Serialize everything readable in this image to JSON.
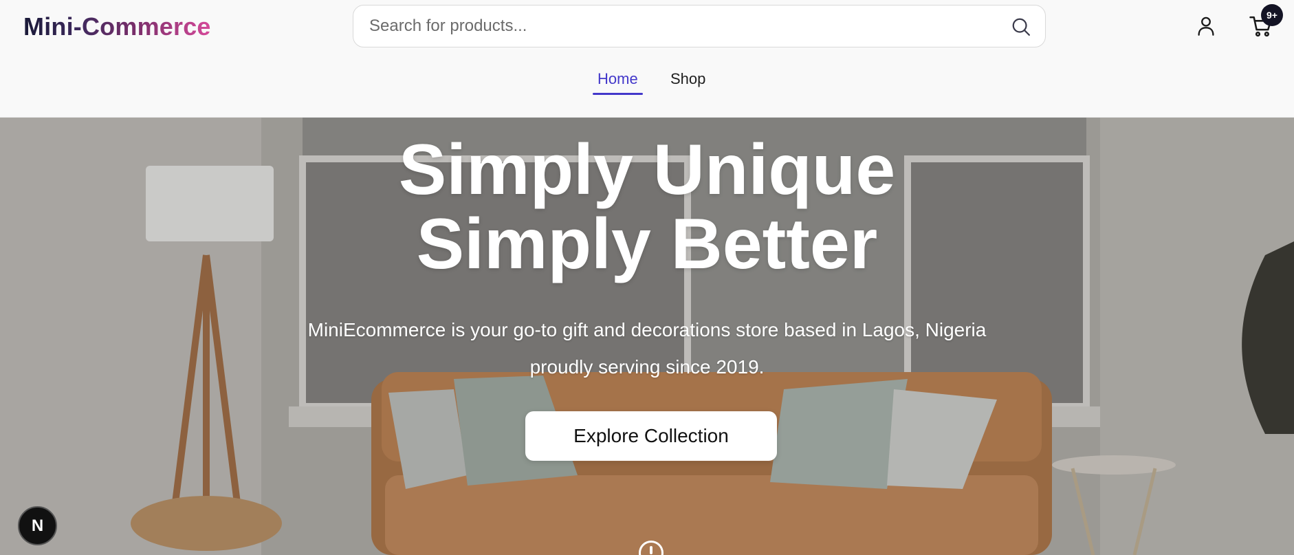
{
  "brand": {
    "logo_text": "Mini-Commerce"
  },
  "search": {
    "placeholder": "Search for products..."
  },
  "cart": {
    "badge": "9+"
  },
  "nav": {
    "items": [
      {
        "label": "Home",
        "active": true
      },
      {
        "label": "Shop",
        "active": false
      }
    ]
  },
  "hero": {
    "title_line1": "Simply Unique",
    "title_line2": "Simply Better",
    "subtitle_line1": "MiniEcommerce is your go-to gift and decorations store based in Lagos, Nigeria",
    "subtitle_line2": "proudly serving since 2019.",
    "cta_label": "Explore Collection"
  },
  "dev_badge": {
    "label": "N"
  },
  "colors": {
    "accent": "#4338ca",
    "badge_bg": "#141425",
    "logo_gradient_start": "#1a1a38",
    "logo_gradient_end": "#d64a9a"
  },
  "icons": {
    "search": "search-icon",
    "user": "user-icon",
    "cart": "cart-icon",
    "scroll": "scroll-indicator-icon"
  }
}
